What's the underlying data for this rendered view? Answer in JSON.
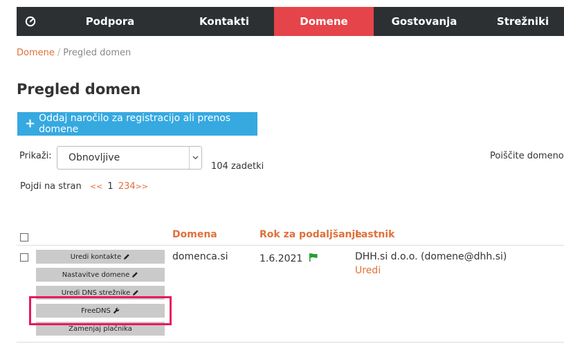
{
  "nav": {
    "logo_icon": "speedometer-icon",
    "items": [
      {
        "label": "Podpora",
        "active": false
      },
      {
        "label": "Kontakti",
        "active": false
      },
      {
        "label": "Domene",
        "active": true
      },
      {
        "label": "Gostovanja",
        "active": false
      },
      {
        "label": "Strežniki",
        "active": false
      }
    ]
  },
  "breadcrumb": {
    "parent": "Domene",
    "separator": "/",
    "current": "Pregled domen"
  },
  "page": {
    "title": "Pregled domen",
    "order_button": "Oddaj naročilo za registracijo ali prenos domene"
  },
  "filter": {
    "show_label": "Prikaži:",
    "selected": "Obnovljive",
    "results": "104 zadetki",
    "search_label": "Poiščite domeno"
  },
  "pager": {
    "label": "Pojdi na stran",
    "prev": "<<",
    "pages": [
      "1",
      "2",
      "3",
      "4"
    ],
    "current": "1",
    "next": ">>"
  },
  "table": {
    "headers": {
      "domain": "Domena",
      "renewal": "Rok za podaljšanje",
      "owner": "Lastnik"
    },
    "rows": [
      {
        "actions": [
          {
            "label": "Uredi kontakte",
            "icon": "pencil-icon"
          },
          {
            "label": "Nastavitve domene",
            "icon": "pencil-icon"
          },
          {
            "label": "Uredi DNS strežnike",
            "icon": "pencil-icon"
          },
          {
            "label": "FreeDNS",
            "icon": "wrench-icon"
          },
          {
            "label": "Zamenjaj plačnika",
            "icon": ""
          }
        ],
        "domain": "domenca.si",
        "renewal": "1.6.2021",
        "renewal_icon": "flag-icon",
        "owner": "DHH.si d.o.o. (domene@dhh.si)",
        "owner_edit": "Uredi"
      }
    ]
  },
  "colors": {
    "nav_bg": "#2d3033",
    "nav_active": "#e5454a",
    "accent": "#e0703a",
    "button_blue": "#36a9e1",
    "highlight": "#e8195a",
    "flag_green": "#1e9e2e"
  }
}
